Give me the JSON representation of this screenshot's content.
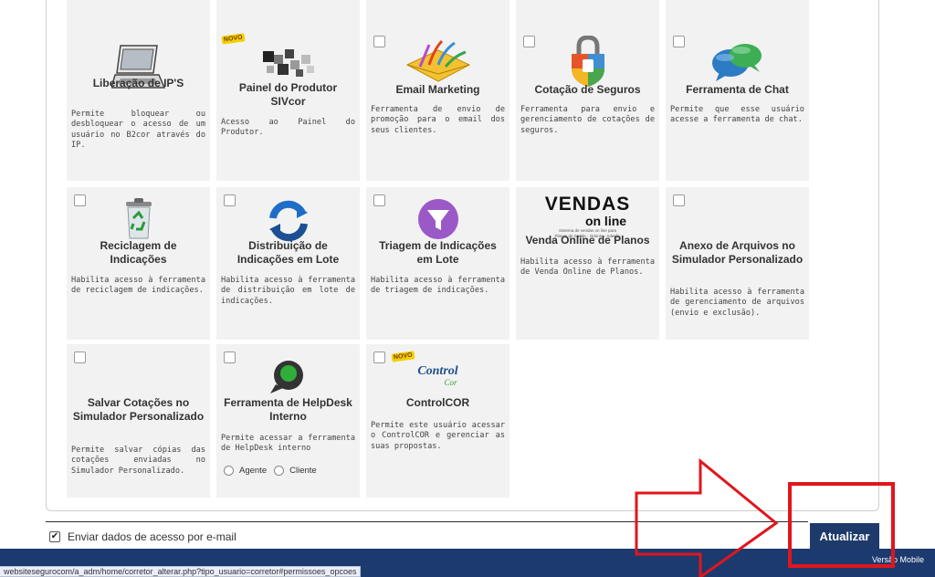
{
  "cards": [
    {
      "id": "liberacao-ip",
      "title": "Liberação de IP'S",
      "desc": "Permite bloquear ou desbloquear o acesso de um usuário no B2cor através do IP.",
      "checkbox": false,
      "novo": false
    },
    {
      "id": "painel-produtor",
      "title": "Painel do Produtor SIVcor",
      "desc": "Acesso ao Painel do Produtor.",
      "checkbox": false,
      "novo": true
    },
    {
      "id": "email-marketing",
      "title": "Email Marketing",
      "desc": "Ferramenta de envio de promoção para o email dos seus clientes.",
      "checkbox": true,
      "novo": false
    },
    {
      "id": "cotacao-seguros",
      "title": "Cotação de Seguros",
      "desc": "Ferramenta para envio e gerenciamento de cotações de seguros.",
      "checkbox": true,
      "novo": false
    },
    {
      "id": "ferramenta-chat",
      "title": "Ferramenta de Chat",
      "desc": "Permite que esse usuário acesse a ferramenta de chat.",
      "checkbox": true,
      "novo": false
    },
    {
      "id": "reciclagem",
      "title": "Reciclagem de Indicações",
      "desc": "Habilita acesso à ferramenta de reciclagem de indicações.",
      "checkbox": true,
      "novo": false
    },
    {
      "id": "distribuicao",
      "title": "Distribuição de Indicações em Lote",
      "desc": "Habilita acesso à ferramenta de distribuição em lote de indicações.",
      "checkbox": true,
      "novo": false
    },
    {
      "id": "triagem",
      "title": "Triagem de Indicações em Lote",
      "desc": "Habilita acesso à ferramenta de triagem de indicações.",
      "checkbox": true,
      "novo": false
    },
    {
      "id": "venda-online",
      "title": "Venda Online de Planos",
      "desc": "Habilita acesso à ferramenta de Venda Online de Planos.",
      "checkbox": false,
      "novo": false,
      "logo": {
        "line1": "VENDAS",
        "line2": "on line",
        "tagline": "Sistema de vendas on line para",
        "tagline2": "Planos de Saúde · Odonto · Adesão"
      }
    },
    {
      "id": "anexo-arquivos",
      "title": "Anexo de Arquivos no Simulador Personalizado",
      "desc": "Habilita acesso à ferramenta de gerenciamento de arquivos (envio e exclusão).",
      "checkbox": true,
      "novo": false
    },
    {
      "id": "salvar-cotacoes",
      "title": "Salvar Cotações no Simulador Personalizado",
      "desc": "Permite salvar cópias das cotações enviadas no Simulador Personalizado.",
      "checkbox": true,
      "novo": false
    },
    {
      "id": "helpdesk",
      "title": "Ferramenta de HelpDesk Interno",
      "desc": "Permite acessar a ferramenta de HelpDesk interno",
      "checkbox": true,
      "novo": false,
      "radios": [
        "Agente",
        "Cliente"
      ]
    },
    {
      "id": "controlcor",
      "title": "ControlCOR",
      "desc": "Permite este usuário acessar o ControlCOR e gerenciar as suas propostas.",
      "checkbox": true,
      "novo": true,
      "logo": {
        "line1": "Control",
        "line2": "Cor"
      }
    }
  ],
  "novo_label": "NOVO",
  "footer": {
    "email_label": "Enviar dados de acesso por e-mail",
    "email_checked": true,
    "submit_label": "Atualizar",
    "mobile_label": "Versão Mobile",
    "status_url": "websitesegurocom/a_adm/home/corretor_alterar.php?tipo_usuario=corretor#permissoes_opcoes"
  },
  "colors": {
    "accent": "#1e3a6b",
    "card_bg": "#f2f2f2",
    "annotation": "#e0161d"
  }
}
